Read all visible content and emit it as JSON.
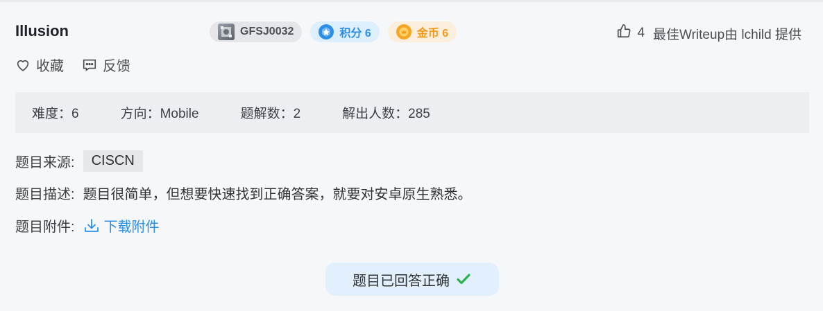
{
  "challenge": {
    "title": "Illusion",
    "id_badge": "GFSJ0032",
    "score_badge": "积分 6",
    "gold_badge": "金币 6"
  },
  "writeup": {
    "likes": "4",
    "text": "最佳Writeup由 lchild 提供"
  },
  "actions": {
    "favorite_label": "收藏",
    "feedback_label": "反馈"
  },
  "stats": {
    "difficulty": "难度：6",
    "direction": "方向：Mobile",
    "solves": "题解数：2",
    "solvers": "解出人数：285"
  },
  "details": {
    "source_label": "题目来源:",
    "source_value": "CISCN",
    "desc_label": "题目描述:",
    "desc_value": "题目很简单，但想要快速找到正确答案，就要对安卓原生熟悉。",
    "attach_label": "题目附件:",
    "attach_link": "下载附件"
  },
  "status": {
    "solved_label": "题目已回答正确"
  },
  "icons": {
    "id_icon": "challenge-avatar-icon",
    "score_icon": "hexagon-score-icon",
    "gold_icon": "gold-coin-icon",
    "like_icon": "thumbs-up-icon",
    "favorite_icon": "heart-icon",
    "feedback_icon": "message-icon",
    "download_icon": "download-icon",
    "solved_icon": "checkmark-icon"
  },
  "colors": {
    "accent_blue": "#2b8fe8",
    "gold": "#f29a18",
    "success_green": "#2ab24c"
  }
}
